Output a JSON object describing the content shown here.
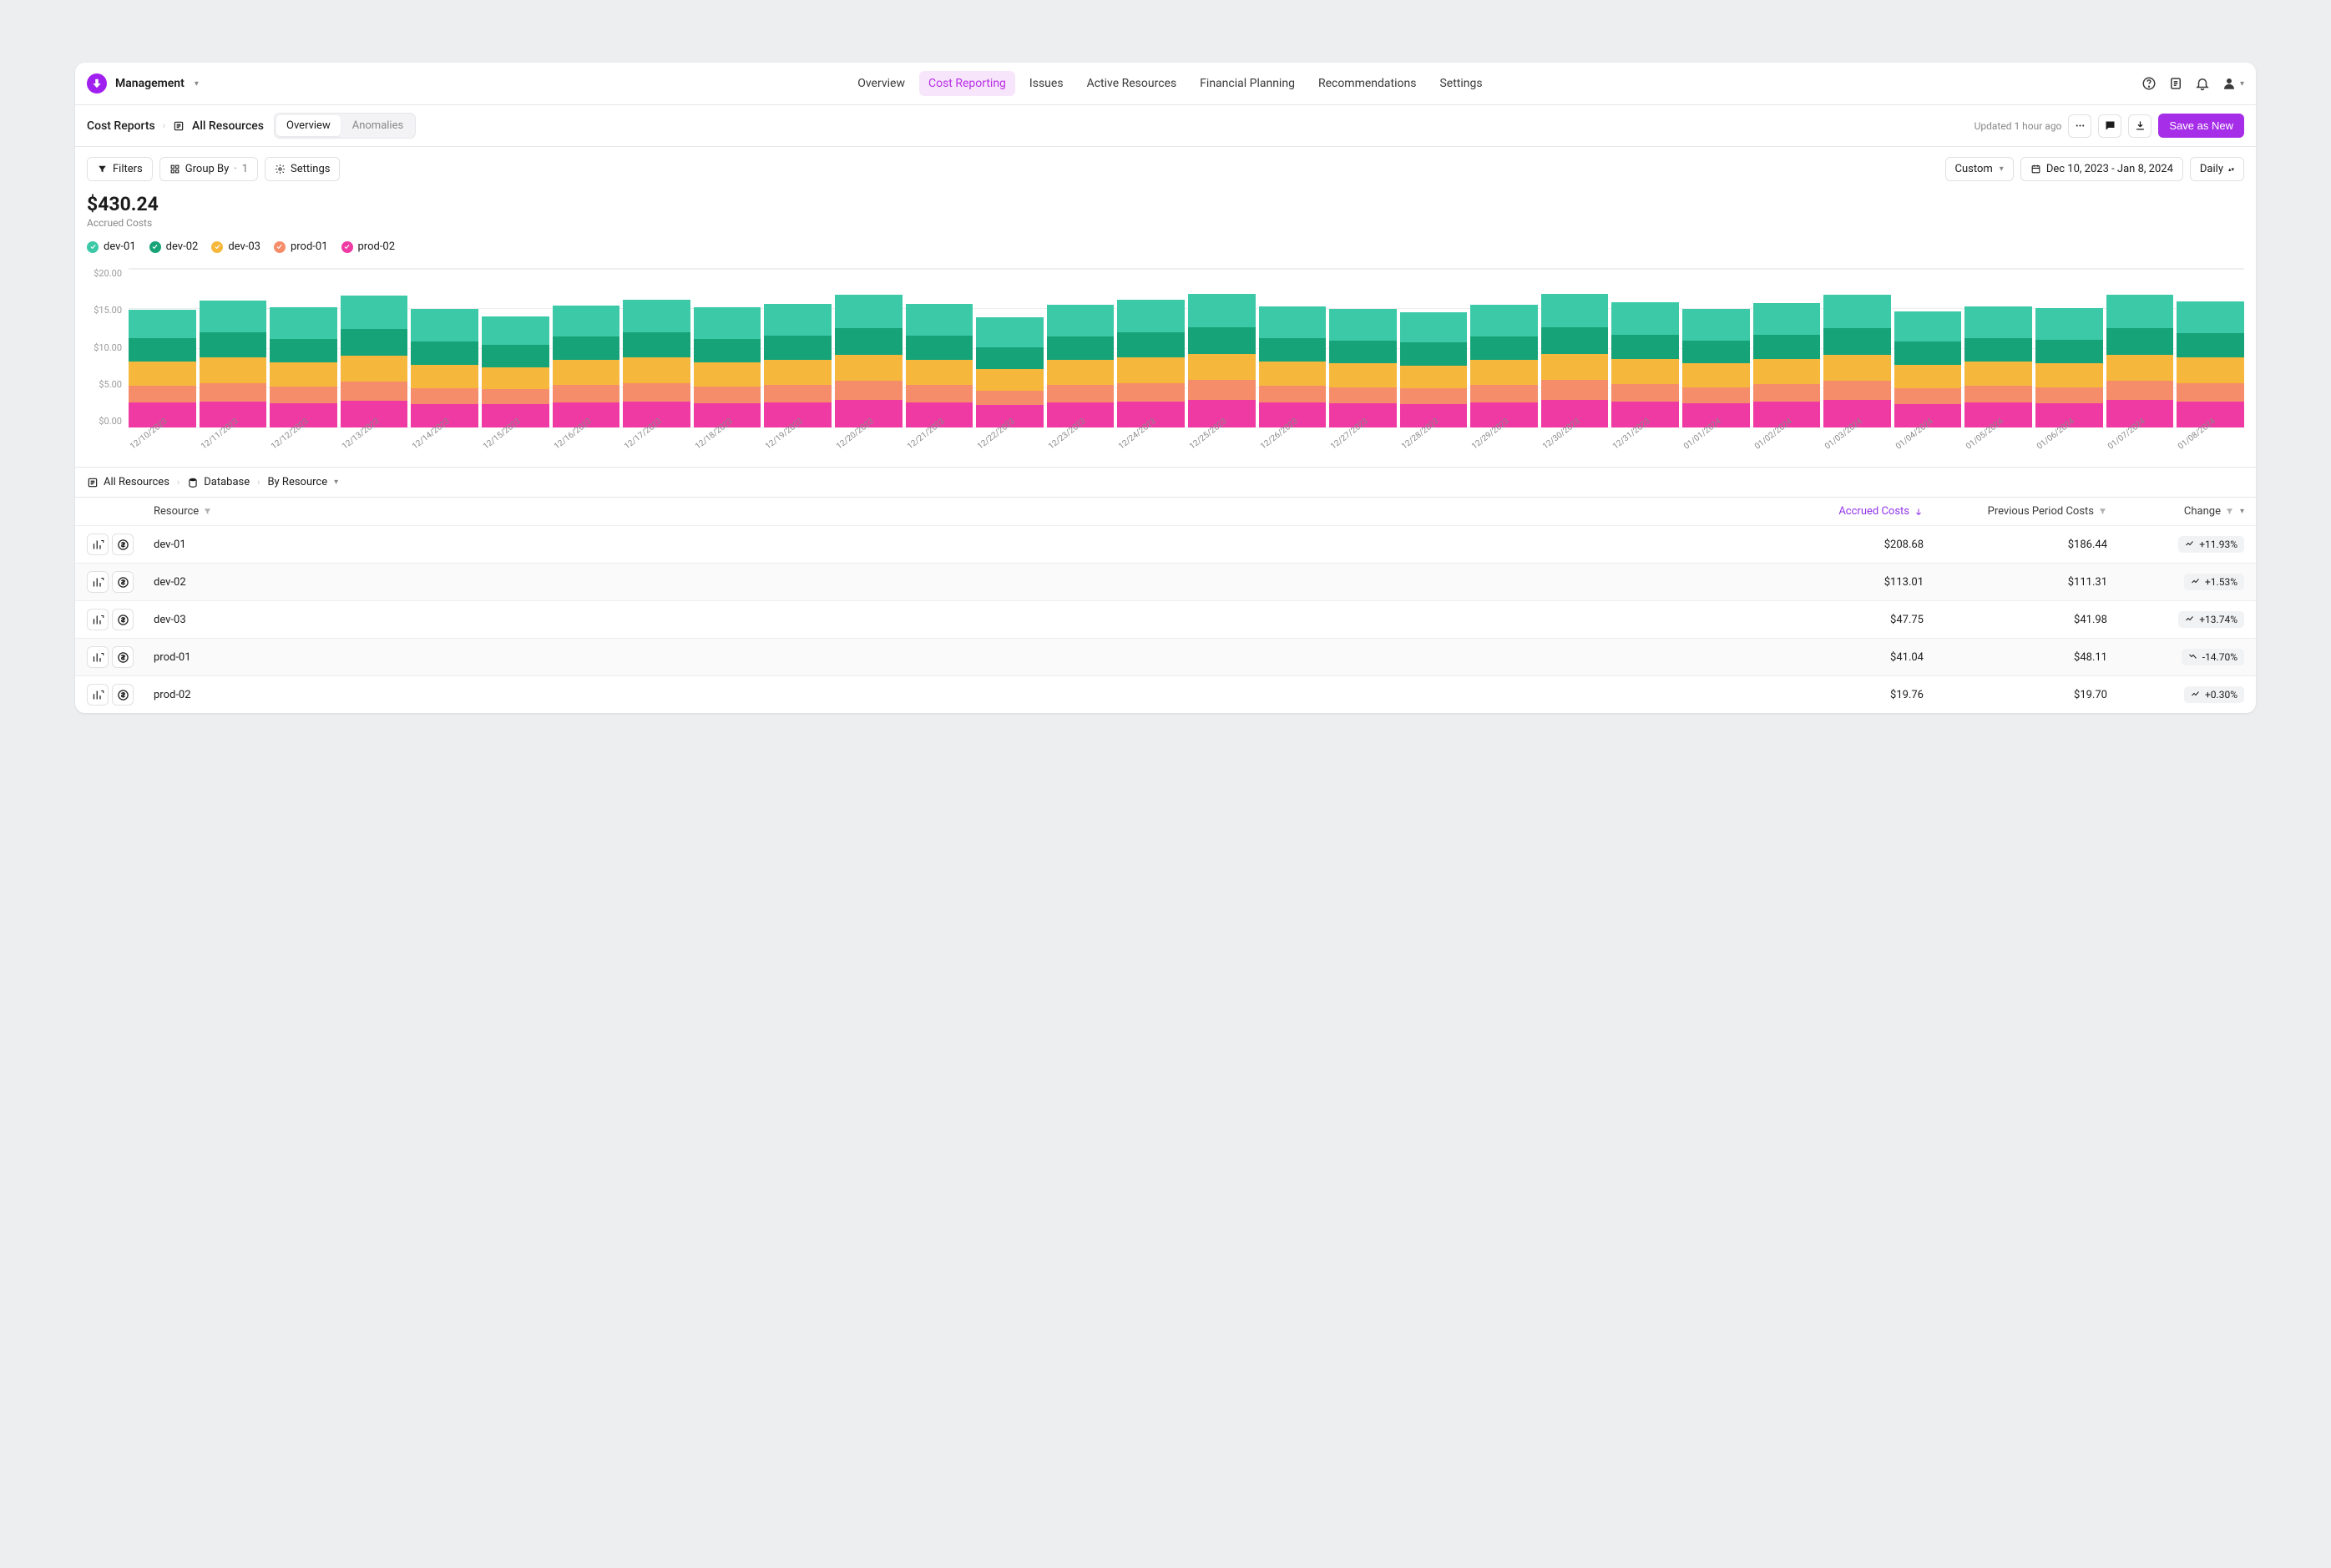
{
  "workspace": "Management",
  "nav": [
    "Overview",
    "Cost Reporting",
    "Issues",
    "Active Resources",
    "Financial Planning",
    "Recommendations",
    "Settings"
  ],
  "nav_active": 1,
  "breadcrumb": {
    "l1": "Cost Reports",
    "l2": "All Resources"
  },
  "tabs": [
    "Overview",
    "Anomalies"
  ],
  "tab_active": 0,
  "updated": "Updated 1 hour ago",
  "primary": "Save as New",
  "toolbar": {
    "filters": "Filters",
    "group": "Group By",
    "group_count": "1",
    "settings": "Settings",
    "preset": "Custom",
    "range": "Dec 10, 2023 - Jan 8, 2024",
    "gran": "Daily"
  },
  "summary": {
    "value": "$430.24",
    "label": "Accrued Costs"
  },
  "legend": [
    {
      "name": "dev-01",
      "color": "#3cc9a7"
    },
    {
      "name": "dev-02",
      "color": "#17a378"
    },
    {
      "name": "dev-03",
      "color": "#f5b83d"
    },
    {
      "name": "prod-01",
      "color": "#f58d6a"
    },
    {
      "name": "prod-02",
      "color": "#ef3aa3"
    }
  ],
  "chart_data": {
    "type": "bar",
    "stacked": true,
    "ylabel": "",
    "ylim": [
      0,
      20
    ],
    "yticks": [
      "$20.00",
      "$15.00",
      "$10.00",
      "$5.00",
      "$0.00"
    ],
    "categories": [
      "12/10/2023",
      "12/11/2023",
      "12/12/2023",
      "12/13/2023",
      "12/14/2023",
      "12/15/2023",
      "12/16/2023",
      "12/17/2023",
      "12/18/2023",
      "12/19/2023",
      "12/20/2023",
      "12/21/2023",
      "12/22/2023",
      "12/23/2023",
      "12/24/2023",
      "12/25/2023",
      "12/26/2023",
      "12/27/2023",
      "12/28/2023",
      "12/29/2023",
      "12/30/2023",
      "12/31/2023",
      "01/01/2024",
      "01/02/2024",
      "01/03/2024",
      "01/04/2024",
      "01/05/2024",
      "01/06/2024",
      "01/07/2024",
      "01/08/2024"
    ],
    "series": [
      {
        "name": "prod-02",
        "color": "#ef3aa3",
        "values": [
          3.2,
          3.3,
          3.1,
          3.4,
          3.0,
          2.9,
          3.2,
          3.3,
          3.1,
          3.2,
          3.5,
          3.2,
          2.8,
          3.2,
          3.3,
          3.5,
          3.2,
          3.1,
          3.0,
          3.2,
          3.5,
          3.3,
          3.1,
          3.3,
          3.5,
          3.0,
          3.2,
          3.1,
          3.5,
          3.3
        ]
      },
      {
        "name": "prod-01",
        "color": "#f58d6a",
        "values": [
          2.1,
          2.3,
          2.1,
          2.4,
          2.0,
          1.9,
          2.2,
          2.3,
          2.1,
          2.2,
          2.4,
          2.2,
          1.8,
          2.2,
          2.3,
          2.5,
          2.1,
          2.0,
          1.9,
          2.2,
          2.5,
          2.2,
          2.0,
          2.2,
          2.4,
          2.0,
          2.1,
          2.0,
          2.4,
          2.3
        ]
      },
      {
        "name": "dev-03",
        "color": "#f5b83d",
        "values": [
          3.0,
          3.2,
          3.0,
          3.3,
          2.9,
          2.8,
          3.1,
          3.2,
          3.0,
          3.1,
          3.3,
          3.1,
          2.8,
          3.1,
          3.2,
          3.3,
          3.0,
          3.0,
          2.9,
          3.1,
          3.3,
          3.1,
          3.0,
          3.1,
          3.3,
          2.9,
          3.0,
          3.0,
          3.3,
          3.2
        ]
      },
      {
        "name": "dev-02",
        "color": "#17a378",
        "values": [
          3.0,
          3.2,
          3.0,
          3.3,
          2.9,
          2.8,
          3.0,
          3.2,
          3.0,
          3.1,
          3.3,
          3.1,
          2.7,
          3.0,
          3.2,
          3.3,
          3.0,
          2.9,
          2.9,
          3.0,
          3.3,
          3.1,
          2.9,
          3.1,
          3.3,
          2.9,
          3.0,
          3.0,
          3.3,
          3.1
        ]
      },
      {
        "name": "dev-01",
        "color": "#3cc9a7",
        "values": [
          3.5,
          4.0,
          4.0,
          4.2,
          4.1,
          3.6,
          3.9,
          4.1,
          4.0,
          4.0,
          4.2,
          4.0,
          3.8,
          4.0,
          4.1,
          4.2,
          4.0,
          3.9,
          3.8,
          4.0,
          4.2,
          4.1,
          4.0,
          4.0,
          4.2,
          3.8,
          4.0,
          4.0,
          4.2,
          4.0
        ]
      }
    ]
  },
  "pathbar": {
    "a": "All Resources",
    "b": "Database",
    "c": "By Resource"
  },
  "thead": {
    "r": "Resource",
    "a": "Accrued Costs",
    "p": "Previous Period Costs",
    "c": "Change"
  },
  "rows": [
    {
      "r": "dev-01",
      "a": "$208.68",
      "p": "$186.44",
      "c": "+11.93%",
      "up": true
    },
    {
      "r": "dev-02",
      "a": "$113.01",
      "p": "$111.31",
      "c": "+1.53%",
      "up": true
    },
    {
      "r": "dev-03",
      "a": "$47.75",
      "p": "$41.98",
      "c": "+13.74%",
      "up": true
    },
    {
      "r": "prod-01",
      "a": "$41.04",
      "p": "$48.11",
      "c": "-14.70%",
      "up": false
    },
    {
      "r": "prod-02",
      "a": "$19.76",
      "p": "$19.70",
      "c": "+0.30%",
      "up": true
    }
  ]
}
